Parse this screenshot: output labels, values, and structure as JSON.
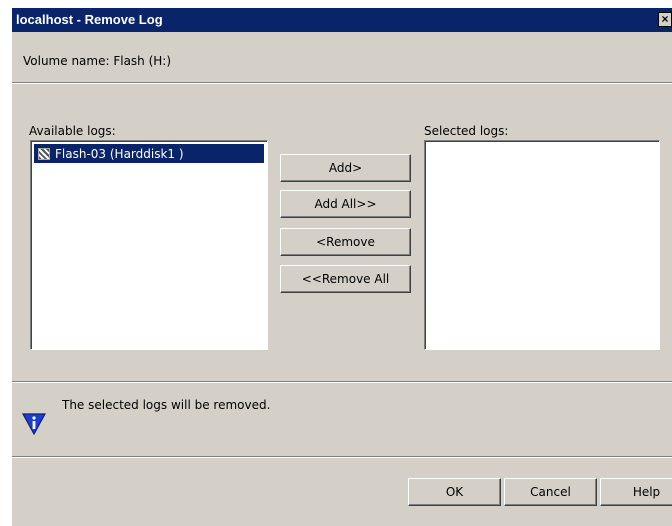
{
  "window": {
    "title": "localhost - Remove Log",
    "close_glyph": "×"
  },
  "volume": {
    "label": "Volume name: Flash (H:)"
  },
  "available": {
    "label": "Available logs:",
    "items": [
      {
        "label": "Flash-03 (Harddisk1 )",
        "selected": true,
        "icon": "disk-icon"
      }
    ]
  },
  "selected": {
    "label": "Selected logs:",
    "items": []
  },
  "buttons": {
    "add": "Add>",
    "add_all": "Add All>>",
    "remove": "<Remove",
    "remove_all": "<<Remove All"
  },
  "info": {
    "icon": "info-icon",
    "message": "The selected logs will be removed."
  },
  "footer": {
    "ok": "OK",
    "cancel": "Cancel",
    "help": "Help"
  },
  "colors": {
    "titlebar": "#0a246a",
    "dialog_bg": "#d4d0c8",
    "selection": "#0a246a",
    "info_icon": "#1a3fcf"
  }
}
